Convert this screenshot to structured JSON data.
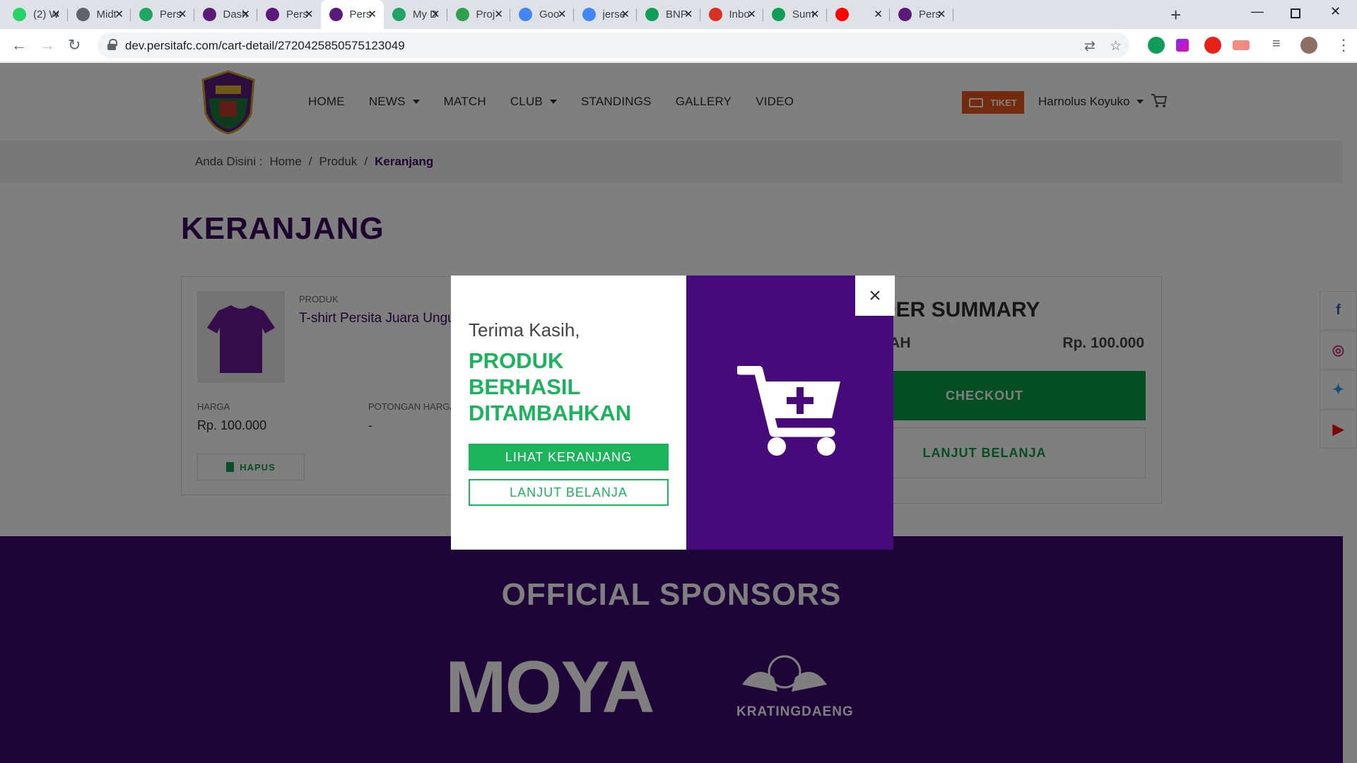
{
  "browser": {
    "tabs": [
      {
        "title": "(2) W",
        "favicon": "whatsapp-icon",
        "color": "#25d366"
      },
      {
        "title": "Midt",
        "favicon": "globe-icon",
        "color": "#5f6368"
      },
      {
        "title": "Pers",
        "favicon": "google-drive-icon",
        "color": "#1fa463"
      },
      {
        "title": "Dash",
        "favicon": "persita-icon",
        "color": "#5b1a7a"
      },
      {
        "title": "Pers",
        "favicon": "persita-icon",
        "color": "#5b1a7a"
      },
      {
        "title": "Pers",
        "favicon": "persita-icon",
        "color": "#5b1a7a"
      },
      {
        "title": "My D",
        "favicon": "google-drive-icon",
        "color": "#1fa463"
      },
      {
        "title": "Proj",
        "favicon": "project-icon",
        "color": "#2e9f4c"
      },
      {
        "title": "Goo",
        "favicon": "google-translate-icon",
        "color": "#4285f4"
      },
      {
        "title": "jerse",
        "favicon": "google-icon",
        "color": "#4285f4"
      },
      {
        "title": "BNP",
        "favicon": "sheets-icon",
        "color": "#0f9d58"
      },
      {
        "title": "Inbo",
        "favicon": "gmail-icon",
        "color": "#d93025"
      },
      {
        "title": "Sum",
        "favicon": "sheets-icon",
        "color": "#0f9d58"
      },
      {
        "title": "",
        "favicon": "youtube-icon",
        "color": "#ff0000"
      },
      {
        "title": "Pers",
        "favicon": "persita-icon",
        "color": "#5b1a7a"
      }
    ],
    "active_tab": 5,
    "url": "dev.persitafc.com/cart-detail/2720425850575123049"
  },
  "header": {
    "nav": [
      {
        "label": "HOME",
        "dropdown": false
      },
      {
        "label": "NEWS",
        "dropdown": true
      },
      {
        "label": "MATCH",
        "dropdown": false
      },
      {
        "label": "CLUB",
        "dropdown": true
      },
      {
        "label": "STANDINGS",
        "dropdown": false
      },
      {
        "label": "GALLERY",
        "dropdown": false
      },
      {
        "label": "VIDEO",
        "dropdown": false
      }
    ],
    "ticket_label": "TIKET",
    "user_name": "Harnolus Koyuko"
  },
  "breadcrumb": {
    "prefix": "Anda Disini :",
    "items": [
      "Home",
      "/",
      "Produk",
      "/"
    ],
    "current": "Keranjang"
  },
  "page_title": "KERANJANG",
  "cart": {
    "product_label": "PRODUK",
    "product_name": "T-shirt Persita Juara Ungu",
    "price_label": "HARGA",
    "price": "Rp. 100.000",
    "discount_label": "POTONGAN HARGA",
    "discount": "-",
    "delete_label": "HAPUS"
  },
  "summary": {
    "title": "ORDER SUMMARY",
    "total_label": "JUMLAH",
    "total_value": "Rp. 100.000",
    "checkout_label": "CHECKOUT",
    "continue_label": "LANJUT BELANJA"
  },
  "social": [
    "facebook-icon",
    "instagram-icon",
    "twitter-icon",
    "youtube-icon"
  ],
  "footer": {
    "sponsors_title": "OFFICIAL SPONSORS",
    "sponsor1": "MOYA",
    "sponsor2": "KRATINGDAENG"
  },
  "modal": {
    "thanks": "Terima Kasih,",
    "success": "PRODUK BERHASIL DITAMBAHKAN",
    "view_cart": "LIHAT KERANJANG",
    "continue": "LANJUT BELANJA",
    "close": "×"
  },
  "colors": {
    "brand_purple": "#3d0a6e",
    "modal_purple": "#470a7a",
    "green": "#1bb35c",
    "ticket_orange": "#e8541b"
  }
}
